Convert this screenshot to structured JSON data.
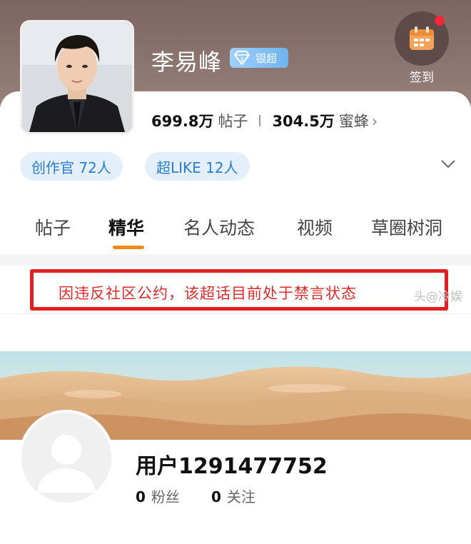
{
  "header": {
    "title": "李易峰",
    "badge": {
      "label": "银超",
      "icon": "diamond-level-icon"
    },
    "checkin": {
      "label": "签到",
      "icon": "calendar-icon",
      "has_notification": true
    },
    "stats": [
      {
        "value": "699.8万",
        "unit": "帖子"
      },
      {
        "value": "304.5万",
        "unit": "蜜蜂"
      }
    ],
    "stats_chevron": "›",
    "chips": [
      {
        "label": "创作官 72人"
      },
      {
        "label": "超LIKE 12人"
      }
    ]
  },
  "tabs": [
    {
      "label": "帖子",
      "active": false
    },
    {
      "label": "精华",
      "active": true
    },
    {
      "label": "名人动态",
      "active": false
    },
    {
      "label": "视频",
      "active": false
    },
    {
      "label": "草圈树洞",
      "active": false
    }
  ],
  "notice": {
    "text": "因违反社区公约，该超话目前处于禁言状态",
    "watermark": "头@冷娱"
  },
  "profile": {
    "username": "用户1291477752",
    "followers": {
      "count": "0",
      "label": "粉丝"
    },
    "following": {
      "count": "0",
      "label": "关注"
    }
  },
  "colors": {
    "header_bg": "#8c7570",
    "accent": "#f08a1c",
    "chip_text": "#2b7bd0",
    "notice_red": "#e21f1f"
  }
}
